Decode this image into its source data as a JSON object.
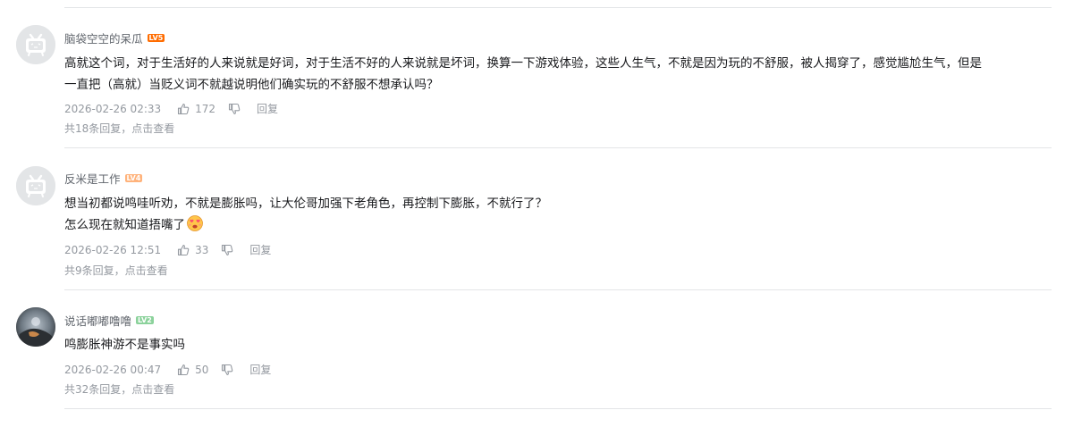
{
  "comments": [
    {
      "username": "脑袋空空的呆瓜",
      "level": "LV5",
      "avatar": "bilibili-default-avatar",
      "content_lines": [
        "高就这个词，对于生活好的人来说就是好词，对于生活不好的人来说就是坏词，换算一下游戏体验，这些人生气，不就是因为玩的不舒服，被人揭穿了，感觉尴尬生气，但是",
        "一直把（高就）当贬义词不就越说明他们确实玩的不舒服不想承认吗？"
      ],
      "time": "2026-02-26 02:33",
      "likes": "172",
      "reply_label": "回复",
      "replies_text": "共18条回复，点击查看"
    },
    {
      "username": "反米是工作",
      "level": "LV4",
      "avatar": "bilibili-default-avatar",
      "content_lines": [
        "想当初都说鸣哇听劝，不就是膨胀吗，让大伦哥加强下老角色，再控制下膨胀，不就行了？",
        "怎么现在就知道捂嘴了"
      ],
      "emote": "heart-eyes-emote",
      "time": "2026-02-26 12:51",
      "likes": "33",
      "reply_label": "回复",
      "replies_text": "共9条回复，点击查看"
    },
    {
      "username": "说话嘟嘟噜噜",
      "level": "LV2",
      "avatar": "photo-avatar",
      "content_lines": [
        "鸣膨胀神游不是事实吗"
      ],
      "time": "2026-02-26 00:47",
      "likes": "50",
      "reply_label": "回复",
      "replies_text": "共32条回复，点击查看"
    }
  ],
  "colors": {
    "username": "#61666d",
    "meta": "#9499a0",
    "divider": "#e3e5e7",
    "lv5": "#ff6c00",
    "lv4": "#ffb37c",
    "lv2": "#8bd29b"
  }
}
